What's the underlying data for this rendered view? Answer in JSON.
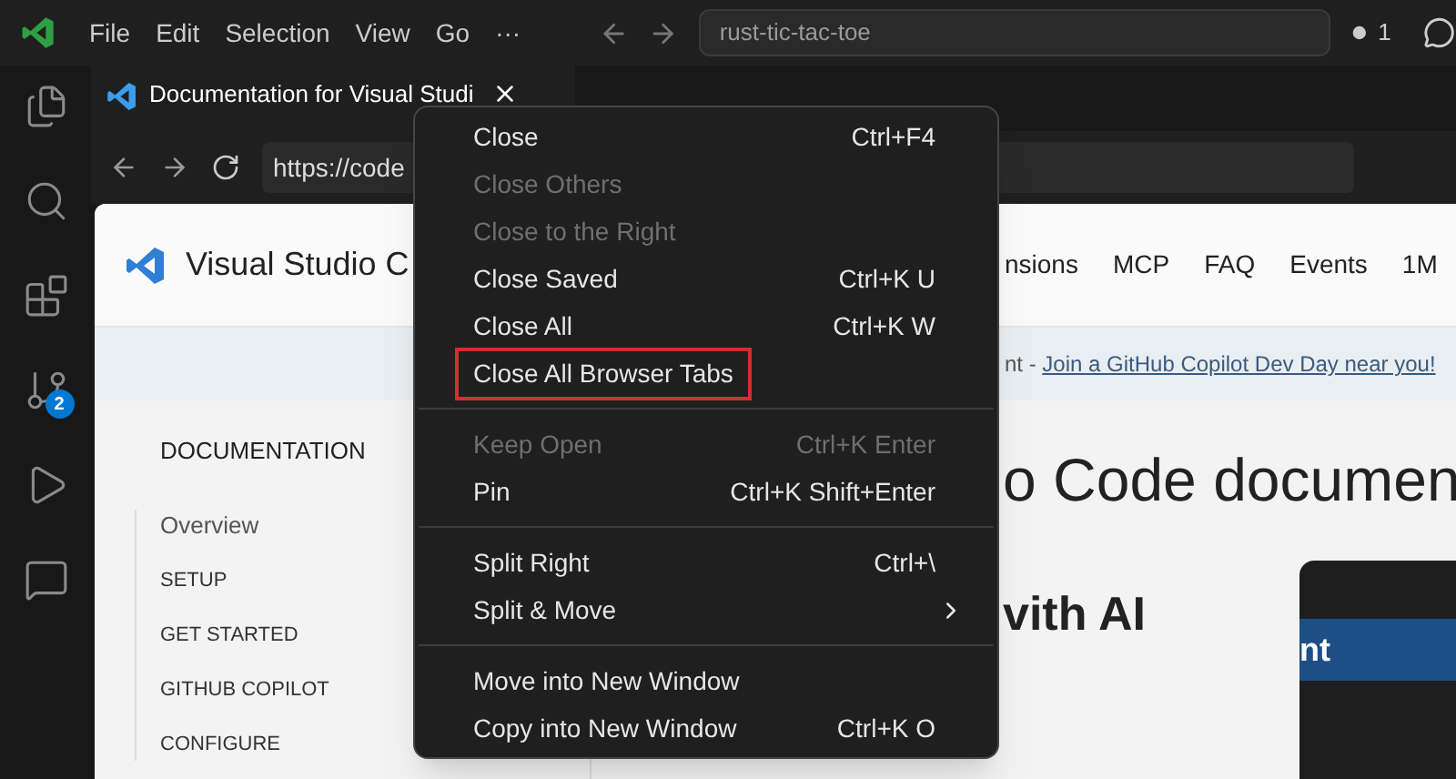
{
  "title_bar": {
    "menu": [
      "File",
      "Edit",
      "Selection",
      "View",
      "Go",
      "···"
    ],
    "command_center": "rust-tic-tac-toe",
    "notifications": "1"
  },
  "activity_bar": {
    "source_control_badge": "2"
  },
  "editor_tab": {
    "title": "Documentation for Visual Studi"
  },
  "browser": {
    "url": "https://code"
  },
  "page": {
    "site_title": "Visual Studio C",
    "nav": [
      "nsions",
      "MCP",
      "FAQ",
      "Events",
      "1M"
    ],
    "banner": {
      "text": "nt - ",
      "link": "Join a GitHub Copilot Dev Day near you!"
    },
    "sidebar": {
      "heading": "DOCUMENTATION",
      "items": [
        {
          "label": "Overview",
          "kind": "page"
        },
        {
          "label": "SETUP",
          "kind": "section"
        },
        {
          "label": "GET STARTED",
          "kind": "section"
        },
        {
          "label": "GITHUB COPILOT",
          "kind": "section"
        },
        {
          "label": "CONFIGURE",
          "kind": "section"
        }
      ]
    },
    "heading": "o Code documen",
    "subheading": "vith AI",
    "promo_card": "nt"
  },
  "context_menu": {
    "items": [
      {
        "kind": "item",
        "label": "Close",
        "shortcut": "Ctrl+F4",
        "disabled": false,
        "highlighted": false
      },
      {
        "kind": "item",
        "label": "Close Others",
        "disabled": true,
        "highlighted": false
      },
      {
        "kind": "item",
        "label": "Close to the Right",
        "disabled": true,
        "highlighted": false
      },
      {
        "kind": "item",
        "label": "Close Saved",
        "shortcut": "Ctrl+K U",
        "disabled": false,
        "highlighted": false
      },
      {
        "kind": "item",
        "label": "Close All",
        "shortcut": "Ctrl+K W",
        "disabled": false,
        "highlighted": false
      },
      {
        "kind": "item",
        "label": "Close All Browser Tabs",
        "disabled": false,
        "highlighted": true
      },
      {
        "kind": "separator"
      },
      {
        "kind": "item",
        "label": "Keep Open",
        "shortcut": "Ctrl+K Enter",
        "disabled": true,
        "highlighted": false
      },
      {
        "kind": "item",
        "label": "Pin",
        "shortcut": "Ctrl+K Shift+Enter",
        "disabled": false,
        "highlighted": false
      },
      {
        "kind": "separator"
      },
      {
        "kind": "item",
        "label": "Split Right",
        "shortcut": "Ctrl+\\",
        "disabled": false,
        "highlighted": false
      },
      {
        "kind": "submenu",
        "label": "Split & Move",
        "disabled": false,
        "highlighted": false
      },
      {
        "kind": "separator"
      },
      {
        "kind": "item",
        "label": "Move into New Window",
        "disabled": false,
        "highlighted": false
      },
      {
        "kind": "item",
        "label": "Copy into New Window",
        "shortcut": "Ctrl+K O",
        "disabled": false,
        "highlighted": false
      }
    ]
  }
}
